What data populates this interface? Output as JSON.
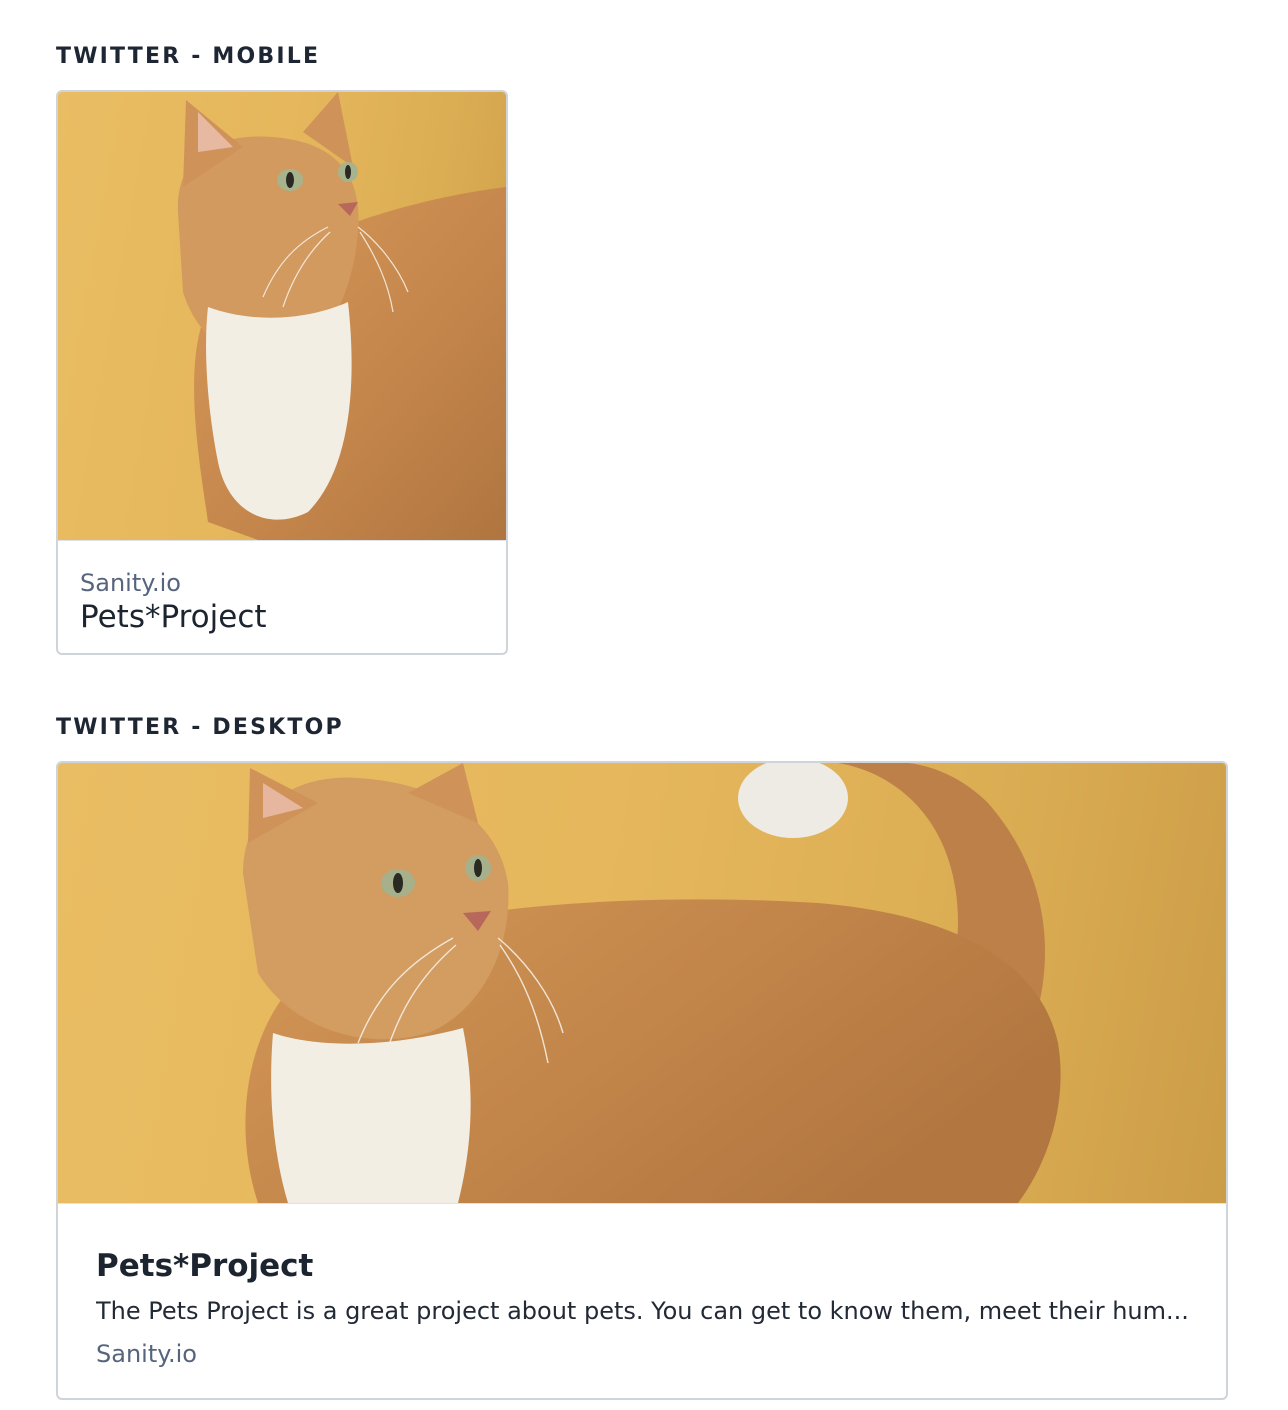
{
  "sections": {
    "mobile": {
      "label": "TWITTER - MOBILE",
      "site": "Sanity.io",
      "title": "Pets*Project"
    },
    "desktop": {
      "label": "TWITTER - DESKTOP",
      "title": "Pets*Project",
      "description": "The Pets Project is a great project about pets. You can get to know them, meet their hum...",
      "site": "Sanity.io"
    }
  },
  "image": {
    "subject": "orange-tabby-cat-photo"
  },
  "colors": {
    "background_photo": "#e6b75c",
    "cat_fur": "#c98a4b",
    "cat_chest": "#f4efe6",
    "label_text": "#1f2633",
    "site_text": "#56657d",
    "card_border": "#cfd3da"
  }
}
